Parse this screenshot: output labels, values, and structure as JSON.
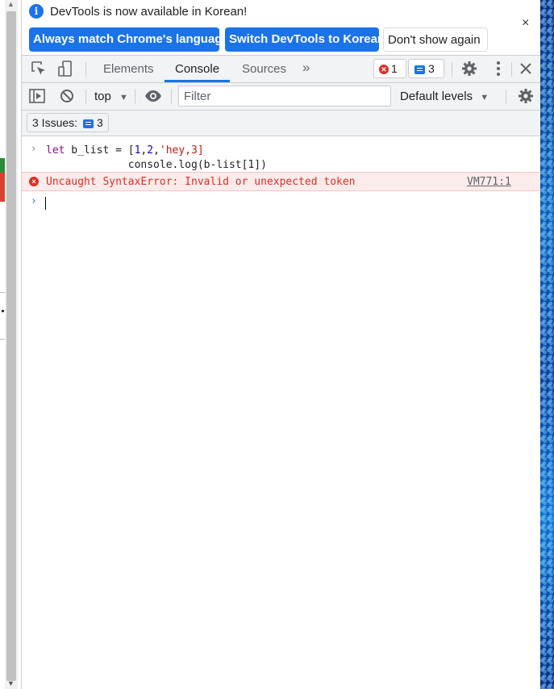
{
  "infobar": {
    "message": "DevTools is now available in Korean!",
    "info_icon": "i",
    "buttons": {
      "match_language": "Always match Chrome's language",
      "switch_korean": "Switch DevTools to Korean",
      "dont_show": "Don't show again"
    },
    "close_glyph": "×"
  },
  "tabs": {
    "items": [
      "Elements",
      "Console",
      "Sources"
    ],
    "active": "Console",
    "more_glyph": "»",
    "error_count": "1",
    "message_count": "3",
    "close_glyph": "✕"
  },
  "toolbar": {
    "context": "top",
    "context_arrow": "▼",
    "filter_placeholder": "Filter",
    "levels": "Default levels",
    "levels_arrow": "▼"
  },
  "issues": {
    "label": "3 Issues:",
    "count": "3"
  },
  "console": {
    "input_line1_kw": "let",
    "input_line1_rest": " b_list = [",
    "input_line1_n1": "1",
    "input_line1_c1": ",",
    "input_line1_n2": "2",
    "input_line1_c2": ",",
    "input_line1_str": "'hey,3]",
    "input_line2": "             console.log(b-list[1])",
    "error_message": "Uncaught SyntaxError: Invalid or unexpected token",
    "error_source": "VM771:1",
    "error_glyph": "×",
    "prompt_glyph": "›",
    "input_arrow": "›"
  },
  "colors": {
    "accent": "#1a73e8",
    "error": "#d93025",
    "error_bg": "#fcebeb",
    "toolbar_bg": "#f1f3f4"
  },
  "icons": [
    "info-icon",
    "close-icon",
    "inspect-element-icon",
    "device-toolbar-icon",
    "chevron-double-right-icon",
    "error-icon",
    "message-icon",
    "gear-icon",
    "kebab-menu-icon",
    "sidebar-toggle-icon",
    "clear-console-icon",
    "eye-icon"
  ]
}
